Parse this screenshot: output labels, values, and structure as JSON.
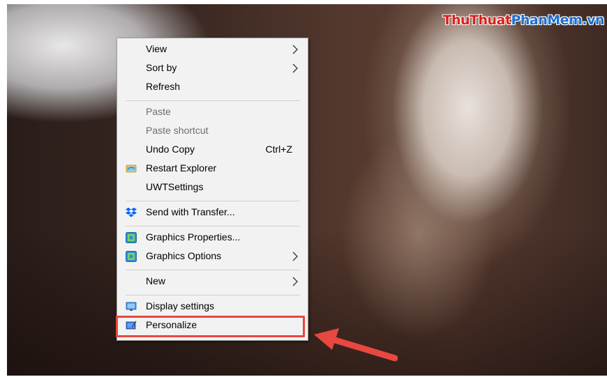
{
  "watermark": {
    "part1": "ThuThuat",
    "part2": "PhanMem",
    "part3": ".vn",
    "color1": "#d9201a",
    "color2": "#1e6fd0"
  },
  "menu": {
    "items": [
      {
        "label": "View",
        "submenu": true
      },
      {
        "label": "Sort by",
        "submenu": true
      },
      {
        "label": "Refresh"
      },
      {
        "label": "Paste",
        "disabled": true
      },
      {
        "label": "Paste shortcut",
        "disabled": true
      },
      {
        "label": "Undo Copy",
        "shortcut": "Ctrl+Z"
      },
      {
        "label": "Restart Explorer",
        "icon": "restart-explorer-icon"
      },
      {
        "label": "UWTSettings"
      },
      {
        "label": "Send with Transfer...",
        "icon": "dropbox-icon"
      },
      {
        "label": "Graphics Properties...",
        "icon": "intel-graphics-icon"
      },
      {
        "label": "Graphics Options",
        "icon": "intel-graphics-icon",
        "submenu": true
      },
      {
        "label": "New",
        "submenu": true
      },
      {
        "label": "Display settings",
        "icon": "display-icon"
      },
      {
        "label": "Personalize",
        "icon": "personalize-icon",
        "highlighted": true
      }
    ]
  },
  "colors": {
    "menu_bg": "#f2f2f2",
    "highlight": "#e8483f",
    "arrow": "#e8483f"
  }
}
